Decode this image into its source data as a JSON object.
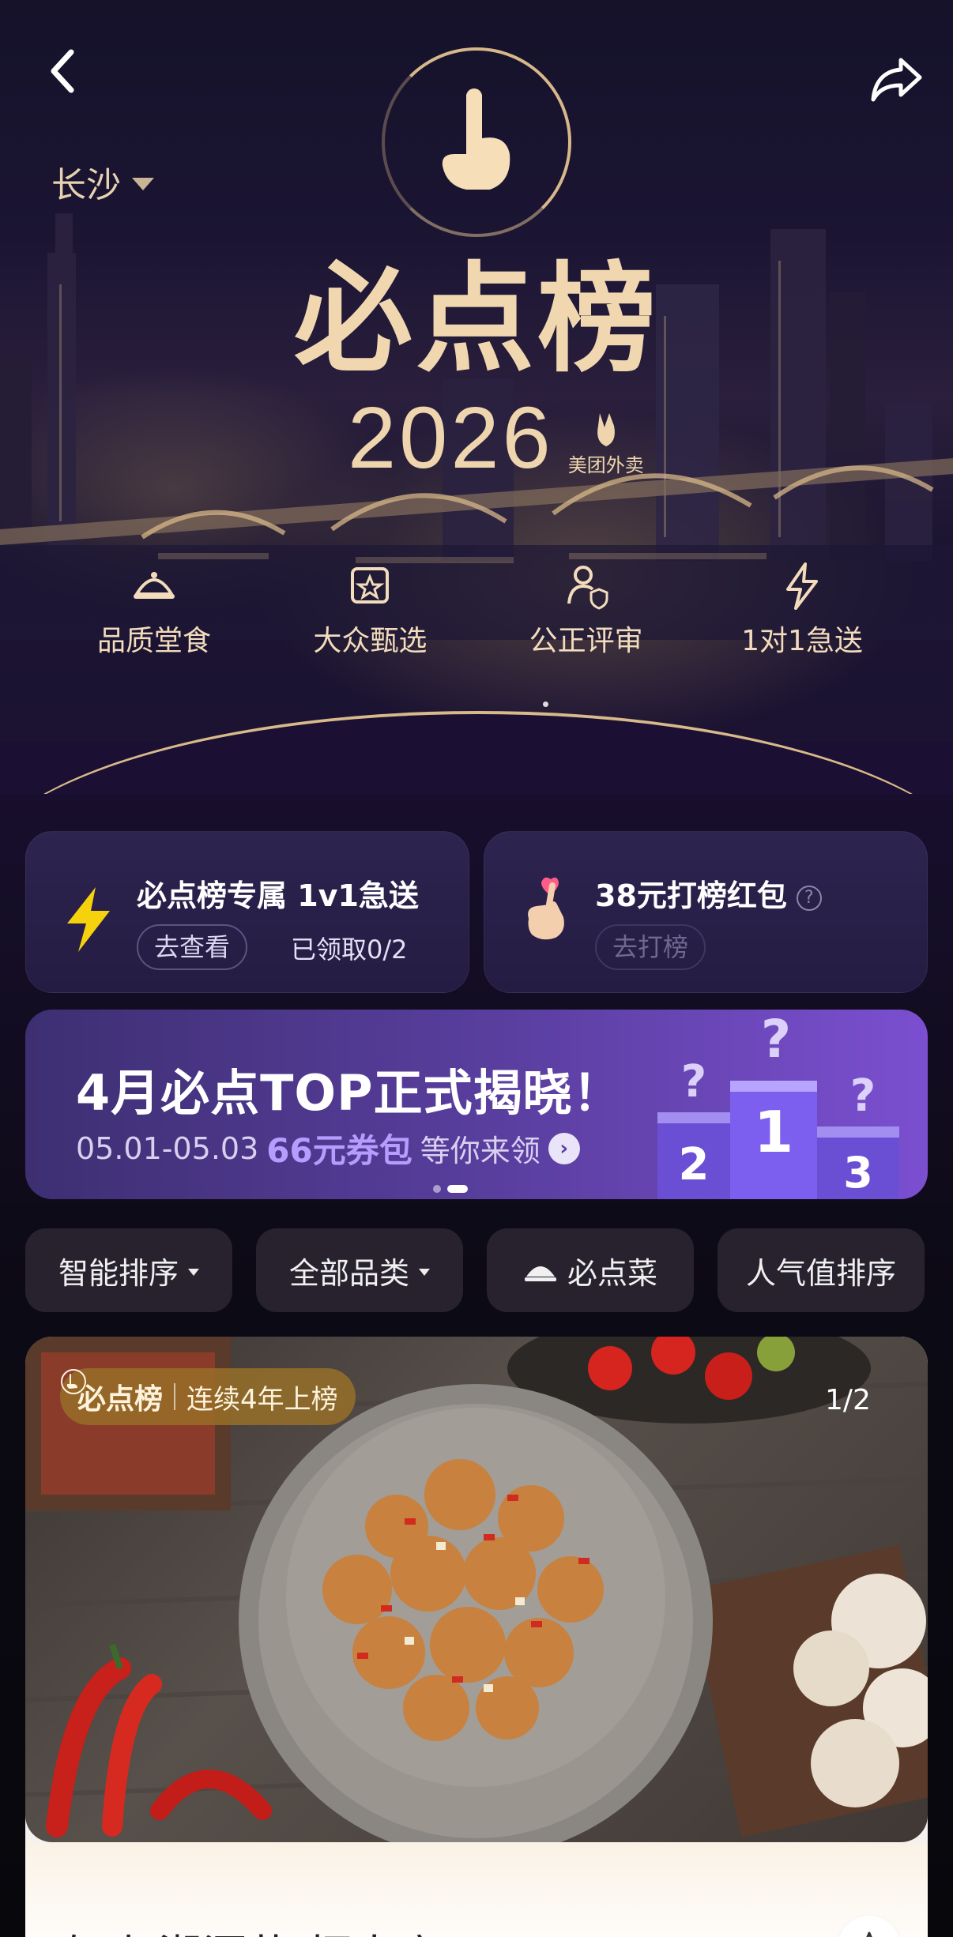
{
  "header": {
    "city": "长沙",
    "brand_title": "必点榜",
    "year": "2026",
    "sub_brand": "美团外卖",
    "features": [
      {
        "icon": "dining-cloche-icon",
        "label": "品质堂食"
      },
      {
        "icon": "selection-badge-icon",
        "label": "大众甄选"
      },
      {
        "icon": "fair-review-icon",
        "label": "公正评审"
      },
      {
        "icon": "lightning-icon",
        "label": "1对1急送"
      }
    ]
  },
  "promos": {
    "express": {
      "title": "必点榜专属 1v1急送",
      "button": "去查看",
      "note": "已领取0/2",
      "icon": "lightning-icon"
    },
    "redpacket": {
      "title": "38元打榜红包",
      "button": "去打榜",
      "icon": "heart-hand-icon"
    }
  },
  "banner": {
    "title": "4月必点TOP正式揭晓！",
    "dates": "05.01-05.03",
    "amount": "66元券包",
    "cta": "等你来领",
    "podium_labels": [
      "2",
      "1",
      "3"
    ],
    "page_index": 2,
    "page_count": 2
  },
  "filters": [
    {
      "label": "智能排序",
      "has_dropdown": true
    },
    {
      "label": "全部品类",
      "has_dropdown": true
    },
    {
      "label": "必点菜",
      "icon": "cloche-icon"
    },
    {
      "label": "人气值排序"
    }
  ],
  "restaurant": {
    "badge_brand": "必点榜",
    "badge_text": "连续4年上榜",
    "photo_counter": "1/2",
    "name": "有味·湘潭菜(恒大店)"
  },
  "colors": {
    "gold": "#e7d2b0",
    "accent_purple": "#5b3fa1",
    "lightning_yellow": "#f6d20d"
  }
}
